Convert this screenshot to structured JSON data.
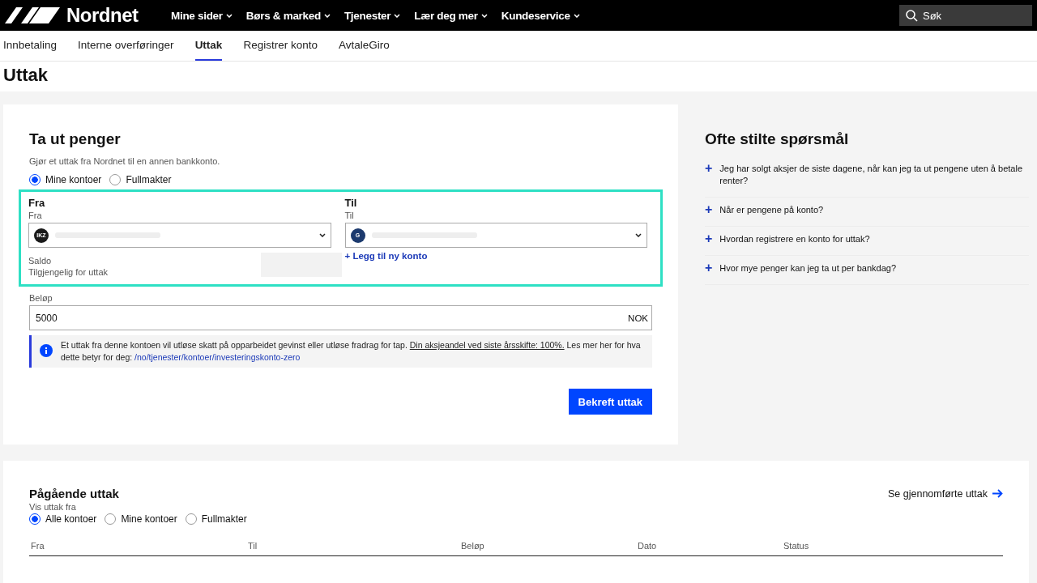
{
  "header": {
    "logo": "Nordnet",
    "menu": [
      {
        "label": "Mine sider"
      },
      {
        "label": "Børs & marked"
      },
      {
        "label": "Tjenester"
      },
      {
        "label": "Lær deg mer"
      },
      {
        "label": "Kundeservice"
      }
    ],
    "search": {
      "placeholder": "Søk"
    }
  },
  "tabs": [
    {
      "label": "Innbetaling",
      "selected": false
    },
    {
      "label": "Interne overføringer",
      "selected": false
    },
    {
      "label": "Uttak",
      "selected": true
    },
    {
      "label": "Registrer konto",
      "selected": false
    },
    {
      "label": "AvtaleGiro",
      "selected": false
    }
  ],
  "page_title": "Uttak",
  "withdraw": {
    "title": "Ta ut penger",
    "subtitle": "Gjør et uttak fra Nordnet til en annen bankkonto.",
    "source_options": [
      {
        "label": "Mine kontoer",
        "selected": true
      },
      {
        "label": "Fullmakter",
        "selected": false
      }
    ],
    "from": {
      "heading": "Fra",
      "label": "Fra",
      "badge": "IKZ",
      "balance_label": "Saldo",
      "available_label": "Tilgjengelig for uttak"
    },
    "to": {
      "heading": "Til",
      "label": "Til",
      "badge": "G",
      "add_link": "+ Legg til ny konto"
    },
    "amount": {
      "label": "Beløp",
      "value": "5000",
      "currency": "NOK"
    },
    "info": {
      "text": "Et uttak fra denne kontoen vil utløse skatt på opparbeidet gevinst eller utløse fradrag for tap. ",
      "underlined": "Din aksjeandel ved siste årsskifte: 100%.",
      "text2": " Les mer her for hva dette betyr for deg: ",
      "link": "/no/tjenester/kontoer/investeringskonto-zero"
    },
    "confirm": "Bekreft uttak"
  },
  "faq": {
    "title": "Ofte stilte spørsmål",
    "items": [
      {
        "icon": "+",
        "question": "Jeg har solgt aksjer de siste dagene, når kan jeg ta ut pengene uten å betale renter?",
        "expanded": false
      },
      {
        "icon": "+",
        "question": "Når er pengene på konto?",
        "expanded": false
      },
      {
        "icon": "+",
        "question": "Hvordan registrere en konto for uttak?",
        "expanded": false
      },
      {
        "icon": "+",
        "question": "Hvor mye penger kan jeg ta ut per bankdag?",
        "expanded": false
      }
    ]
  },
  "pending": {
    "title": "Pågående uttak",
    "link": "Se gjennomførte uttak",
    "filter_label": "Vis uttak fra",
    "filters": [
      {
        "label": "Alle kontoer",
        "selected": true
      },
      {
        "label": "Mine kontoer",
        "selected": false
      },
      {
        "label": "Fullmakter",
        "selected": false
      }
    ],
    "columns": [
      "Fra",
      "Til",
      "Beløp",
      "Dato",
      "Status"
    ]
  }
}
